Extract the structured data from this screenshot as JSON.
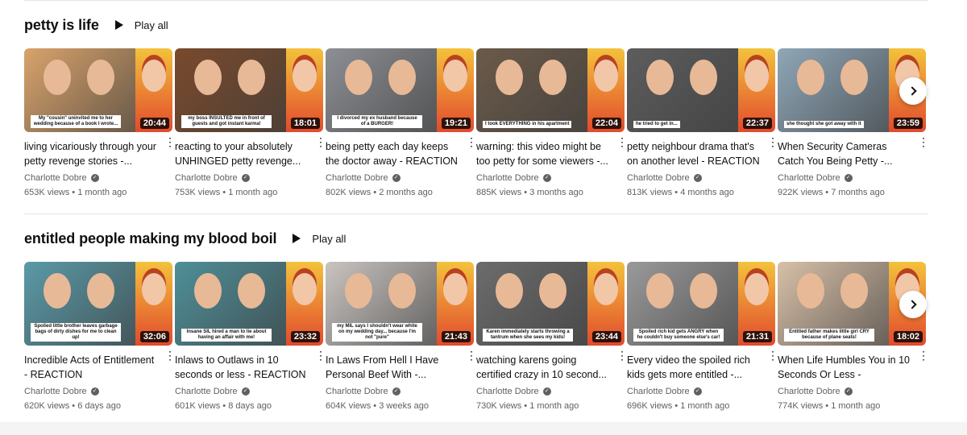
{
  "shelves": [
    {
      "title": "petty is life",
      "play_all": "Play all",
      "videos": [
        {
          "title": "living vicariously through your petty revenge stories -...",
          "channel": "Charlotte Dobre",
          "stats": "653K views • 1 month ago",
          "duration": "20:44",
          "caption": "My \"cousin\" uninvited me to her wedding because of a book I wrote...",
          "color": "#d9a36b"
        },
        {
          "title": "reacting to your absolutely UNHINGED petty revenge...",
          "channel": "Charlotte Dobre",
          "stats": "753K views • 1 month ago",
          "duration": "18:01",
          "caption": "my boss INSULTED me in front of guests and got instant karma!",
          "color": "#7a4a2c"
        },
        {
          "title": "being petty each day keeps the doctor away - REACTION",
          "channel": "Charlotte Dobre",
          "stats": "802K views • 2 months ago",
          "duration": "19:21",
          "caption": "I divorced my ex husband because of a BURGER!",
          "color": "#8c8f94"
        },
        {
          "title": "warning: this video might be too petty for some viewers -...",
          "channel": "Charlotte Dobre",
          "stats": "885K views • 3 months ago",
          "duration": "22:04",
          "caption": "I took EVERYTHING in his apartment",
          "color": "#6b5a4a"
        },
        {
          "title": "petty neighbour drama that's on another level - REACTION",
          "channel": "Charlotte Dobre",
          "stats": "813K views • 4 months ago",
          "duration": "22:37",
          "caption": "he tried to get in...",
          "color": "#5d5d5d"
        },
        {
          "title": "When Security Cameras Catch You Being Petty -...",
          "channel": "Charlotte Dobre",
          "stats": "922K views • 7 months ago",
          "duration": "23:59",
          "caption": "she thought she got away with it",
          "color": "#8fa7b8"
        }
      ]
    },
    {
      "title": "entitled people making my blood boil",
      "play_all": "Play all",
      "videos": [
        {
          "title": "Incredible Acts of Entitlement - REACTION",
          "channel": "Charlotte Dobre",
          "stats": "620K views • 6 days ago",
          "duration": "32:06",
          "caption": "Spoiled little brother leaves garbage bags of dirty dishes for me to clean up!",
          "color": "#5a9aa8"
        },
        {
          "title": "Inlaws to Outlaws in 10 seconds or less - REACTION",
          "channel": "Charlotte Dobre",
          "stats": "601K views • 8 days ago",
          "duration": "23:32",
          "caption": "Insane SIL hired a man to lie about having an affair with me!",
          "color": "#4f8f99"
        },
        {
          "title": "In Laws From Hell I Have Personal Beef With -...",
          "channel": "Charlotte Dobre",
          "stats": "604K views • 3 weeks ago",
          "duration": "21:43",
          "caption": "my MIL says I shouldn't wear white on my wedding day... because I'm not \"pure\"",
          "color": "#c9c4c0"
        },
        {
          "title": "watching karens going certified crazy in 10 second...",
          "channel": "Charlotte Dobre",
          "stats": "730K views • 1 month ago",
          "duration": "23:44",
          "caption": "Karen immediately starts throwing a tantrum when she sees my kids!",
          "color": "#6c6c6c"
        },
        {
          "title": "Every video the spoiled rich kids gets more entitled -...",
          "channel": "Charlotte Dobre",
          "stats": "696K views • 1 month ago",
          "duration": "21:31",
          "caption": "Spoiled rich kid gets ANGRY when he couldn't buy someone else's car!",
          "color": "#9a9a9a"
        },
        {
          "title": "When Life Humbles You in 10 Seconds Or Less - REACTION",
          "channel": "Charlotte Dobre",
          "stats": "774K views • 1 month ago",
          "duration": "18:02",
          "caption": "Entitled father makes little girl CRY because of plane seats!",
          "color": "#d8c0a8"
        }
      ]
    }
  ],
  "icons": {
    "play": "play-icon",
    "more": "more-vert-icon",
    "verified": "verified-check-icon",
    "next": "chevron-right-icon"
  }
}
